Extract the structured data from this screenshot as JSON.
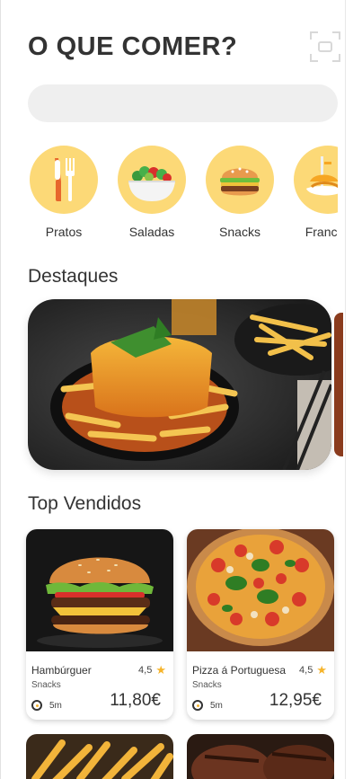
{
  "header": {
    "title": "O QUE COMER?"
  },
  "search": {
    "placeholder": "",
    "value": ""
  },
  "categories": [
    {
      "label": "Pratos",
      "icon": "cutlery-icon"
    },
    {
      "label": "Saladas",
      "icon": "salad-bowl-icon"
    },
    {
      "label": "Snacks",
      "icon": "burger-icon"
    },
    {
      "label": "Frances",
      "icon": "francesinha-icon"
    }
  ],
  "featured": {
    "title": "Destaques"
  },
  "top_sold": {
    "title": "Top Vendidos",
    "items": [
      {
        "name": "Hambúrguer",
        "rating": "4,5",
        "category": "Snacks",
        "time": "5m",
        "price": "11,80€"
      },
      {
        "name": "Pizza á Portuguesa",
        "rating": "4,5",
        "category": "Snacks",
        "time": "5m",
        "price": "12,95€"
      }
    ]
  },
  "colors": {
    "accent": "#fcd977",
    "star": "#f6b42b",
    "search_bg": "#efefef"
  }
}
